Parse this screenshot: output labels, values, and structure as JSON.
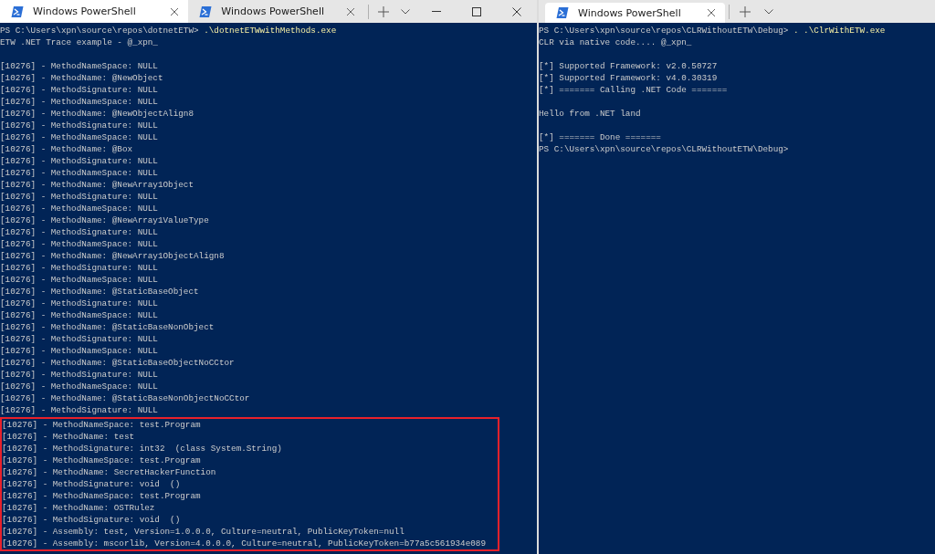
{
  "windows": [
    {
      "tabs": [
        {
          "title": "Windows PowerShell",
          "selected": true
        },
        {
          "title": "Windows PowerShell",
          "selected": false
        }
      ],
      "window_controls": true,
      "terminal": {
        "lines": [
          {
            "kind": "prompt",
            "prompt": "PS C:\\Users\\xpn\\source\\repos\\dotnetETW> ",
            "command": ".\\dotnetETWwithMethods.exe"
          },
          {
            "kind": "output",
            "text": "ETW .NET Trace example - @_xpn_"
          },
          {
            "kind": "blank"
          },
          {
            "kind": "output",
            "text": "[10276] - MethodNameSpace: NULL"
          },
          {
            "kind": "output",
            "text": "[10276] - MethodName: @NewObject"
          },
          {
            "kind": "output",
            "text": "[10276] - MethodSignature: NULL"
          },
          {
            "kind": "output",
            "text": "[10276] - MethodNameSpace: NULL"
          },
          {
            "kind": "output",
            "text": "[10276] - MethodName: @NewObjectAlign8"
          },
          {
            "kind": "output",
            "text": "[10276] - MethodSignature: NULL"
          },
          {
            "kind": "output",
            "text": "[10276] - MethodNameSpace: NULL"
          },
          {
            "kind": "output",
            "text": "[10276] - MethodName: @Box"
          },
          {
            "kind": "output",
            "text": "[10276] - MethodSignature: NULL"
          },
          {
            "kind": "output",
            "text": "[10276] - MethodNameSpace: NULL"
          },
          {
            "kind": "output",
            "text": "[10276] - MethodName: @NewArray1Object"
          },
          {
            "kind": "output",
            "text": "[10276] - MethodSignature: NULL"
          },
          {
            "kind": "output",
            "text": "[10276] - MethodNameSpace: NULL"
          },
          {
            "kind": "output",
            "text": "[10276] - MethodName: @NewArray1ValueType"
          },
          {
            "kind": "output",
            "text": "[10276] - MethodSignature: NULL"
          },
          {
            "kind": "output",
            "text": "[10276] - MethodNameSpace: NULL"
          },
          {
            "kind": "output",
            "text": "[10276] - MethodName: @NewArray1ObjectAlign8"
          },
          {
            "kind": "output",
            "text": "[10276] - MethodSignature: NULL"
          },
          {
            "kind": "output",
            "text": "[10276] - MethodNameSpace: NULL"
          },
          {
            "kind": "output",
            "text": "[10276] - MethodName: @StaticBaseObject"
          },
          {
            "kind": "output",
            "text": "[10276] - MethodSignature: NULL"
          },
          {
            "kind": "output",
            "text": "[10276] - MethodNameSpace: NULL"
          },
          {
            "kind": "output",
            "text": "[10276] - MethodName: @StaticBaseNonObject"
          },
          {
            "kind": "output",
            "text": "[10276] - MethodSignature: NULL"
          },
          {
            "kind": "output",
            "text": "[10276] - MethodNameSpace: NULL"
          },
          {
            "kind": "output",
            "text": "[10276] - MethodName: @StaticBaseObjectNoCCtor"
          },
          {
            "kind": "output",
            "text": "[10276] - MethodSignature: NULL"
          },
          {
            "kind": "output",
            "text": "[10276] - MethodNameSpace: NULL"
          },
          {
            "kind": "output",
            "text": "[10276] - MethodName: @StaticBaseNonObjectNoCCtor"
          },
          {
            "kind": "output",
            "text": "[10276] - MethodSignature: NULL"
          }
        ],
        "highlighted_lines": [
          "[10276] - MethodNameSpace: test.Program",
          "[10276] - MethodName: test",
          "[10276] - MethodSignature: int32  (class System.String)",
          "[10276] - MethodNameSpace: test.Program",
          "[10276] - MethodName: SecretHackerFunction",
          "[10276] - MethodSignature: void  ()",
          "[10276] - MethodNameSpace: test.Program",
          "[10276] - MethodName: OSTRulez",
          "[10276] - MethodSignature: void  ()",
          "[10276] - Assembly: test, Version=1.0.0.0, Culture=neutral, PublicKeyToken=null",
          "[10276] - Assembly: mscorlib, Version=4.0.0.0, Culture=neutral, PublicKeyToken=b77a5c561934e089"
        ]
      }
    },
    {
      "tabs": [
        {
          "title": "Windows PowerShell",
          "selected": true
        }
      ],
      "terminal": {
        "lines": [
          {
            "kind": "prompt",
            "prompt": "PS C:\\Users\\xpn\\source\\repos\\CLRWithoutETW\\Debug> ",
            "command": ". .\\ClrWithETW.exe"
          },
          {
            "kind": "output",
            "text": "CLR via native code.... @_xpn_"
          },
          {
            "kind": "blank"
          },
          {
            "kind": "output",
            "text": "[*] Supported Framework: v2.0.50727"
          },
          {
            "kind": "output",
            "text": "[*] Supported Framework: v4.0.30319"
          },
          {
            "kind": "output",
            "text": "[*] ======= Calling .NET Code ======="
          },
          {
            "kind": "blank"
          },
          {
            "kind": "output",
            "text": "Hello from .NET land"
          },
          {
            "kind": "blank"
          },
          {
            "kind": "output",
            "text": "[*] ======= Done ======="
          },
          {
            "kind": "prompt",
            "prompt": "PS C:\\Users\\xpn\\source\\repos\\CLRWithoutETW\\Debug>"
          }
        ]
      }
    }
  ]
}
